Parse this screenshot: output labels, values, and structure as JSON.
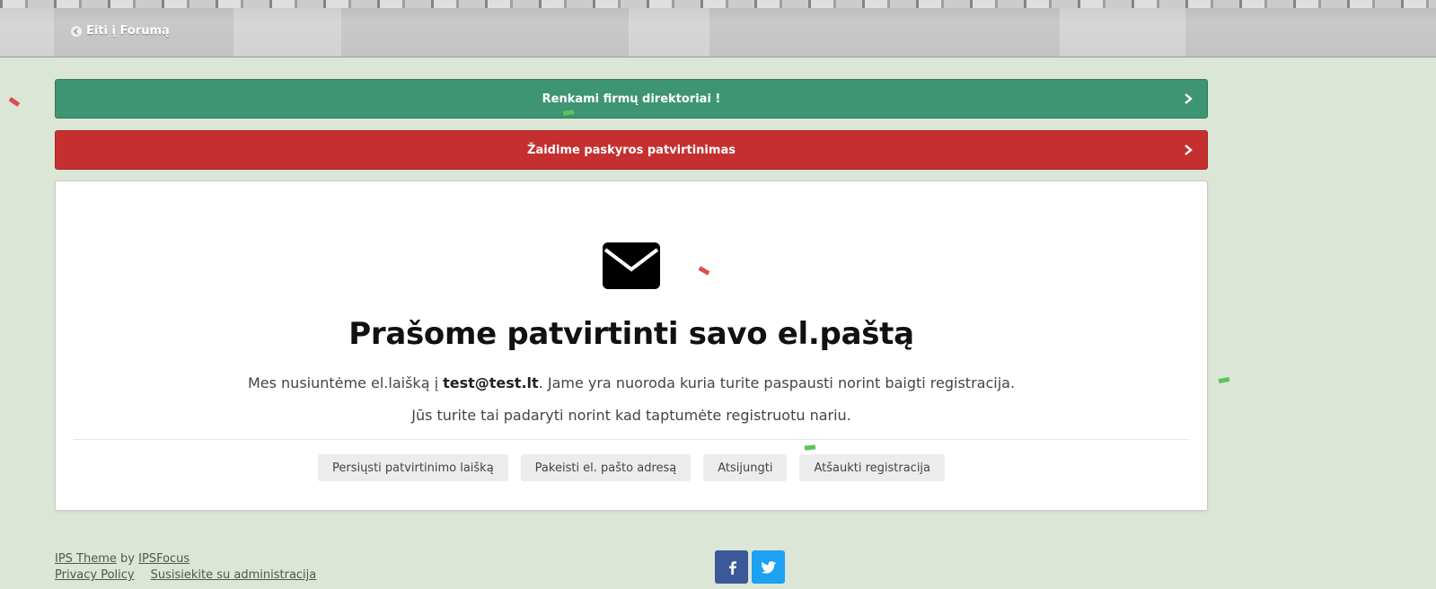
{
  "header": {
    "back_link_label": "Eiti į Forumą"
  },
  "banners": [
    {
      "label": "Renkami firmų direktoriai !",
      "color": "#3e9573"
    },
    {
      "label": "Žaidime paskyros patvirtinimas",
      "color": "#c62f30"
    }
  ],
  "confirm": {
    "title": "Prašome patvirtinti savo el.paštą",
    "line1_before": "Mes nusiuntėme el.laišką į ",
    "email": "test@test.lt",
    "line1_after": ". Jame yra nuoroda kuria turite paspausti norint baigti registracija.",
    "line2": "Jūs turite tai padaryti norint kad taptumėte registruotu nariu.",
    "actions": [
      "Persiųsti patvirtinimo laišką",
      "Pakeisti el. pašto adresą",
      "Atsijungti",
      "Atšaukti registracija"
    ]
  },
  "footer": {
    "theme_label": "IPS Theme",
    "by_label": "by",
    "author_label": "IPSFocus",
    "privacy_label": "Privacy Policy",
    "contact_label": "Susisiekite su administracija"
  },
  "icons": {
    "back": "arrow-left-circle-icon",
    "chevron": "chevron-right-icon",
    "mail": "envelope-icon",
    "facebook": "facebook-icon",
    "twitter": "twitter-icon"
  },
  "colors": {
    "page_bg": "#dbe6d6",
    "green": "#3e9573",
    "red": "#c62f30",
    "facebook": "#3b5998",
    "twitter": "#1da1f2"
  }
}
